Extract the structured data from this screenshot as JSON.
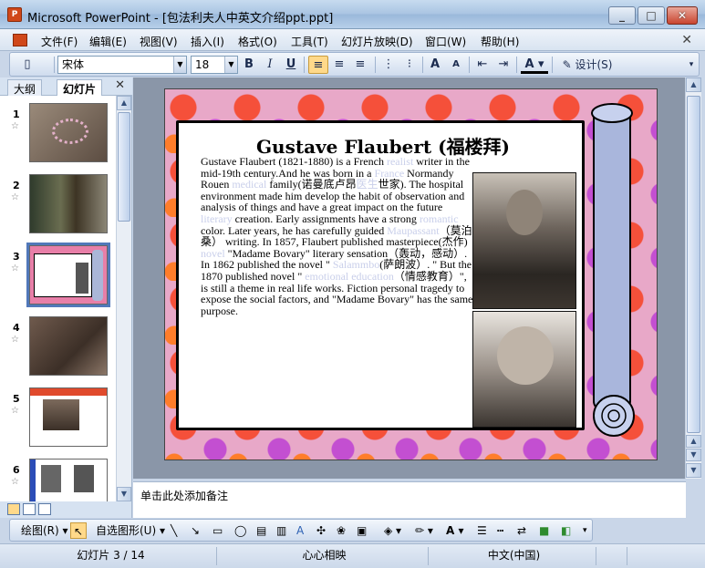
{
  "window": {
    "title": "Microsoft PowerPoint - [包法利夫人中英文介绍ppt.ppt]",
    "app_icon": "powerpoint-icon"
  },
  "menu": {
    "items": [
      "文件(F)",
      "编辑(E)",
      "视图(V)",
      "插入(I)",
      "格式(O)",
      "工具(T)",
      "幻灯片放映(D)",
      "窗口(W)",
      "帮助(H)"
    ]
  },
  "toolbar": {
    "font_name": "宋体",
    "font_size": "18",
    "bold": "B",
    "italic": "I",
    "underline": "U",
    "design_label": "设计(S)"
  },
  "left_pane": {
    "tabs": [
      "大纲",
      "幻灯片"
    ],
    "active_tab": "幻灯片",
    "slides": [
      {
        "num": "1"
      },
      {
        "num": "2"
      },
      {
        "num": "3",
        "selected": true
      },
      {
        "num": "4"
      },
      {
        "num": "5"
      },
      {
        "num": "6"
      }
    ]
  },
  "slide": {
    "title": "Gustave Flaubert (福楼拜)",
    "body_parts": [
      {
        "t": "Gustave Flaubert (1821-1880) is a French "
      },
      {
        "t": "realist",
        "hl": true
      },
      {
        "t": " writer in the mid-19th century.And he was born in a "
      },
      {
        "t": "France",
        "hl": true
      },
      {
        "t": " Normandy Rouen "
      },
      {
        "t": "medical",
        "hl": true
      },
      {
        "t": " family(诺曼底卢昂"
      },
      {
        "t": "医生",
        "hl": true
      },
      {
        "t": "世家). The hospital environment made him develop the habit of observation and analysis of things and have a great impact on the future "
      },
      {
        "t": "literary",
        "hl": true
      },
      {
        "t": " creation.  Early assignments have a strong "
      },
      {
        "t": "romantic",
        "hl": true
      },
      {
        "t": " color. Later years, he has carefully guided "
      },
      {
        "t": "Maupassant",
        "hl": true
      },
      {
        "t": "（莫泊桑） writing. In 1857, Flaubert published masterpiece(杰作) "
      },
      {
        "t": "novel",
        "hl": true
      },
      {
        "t": " \"Madame Bovary\" literary sensation（轰动，感动）. In 1862 published the novel \" "
      },
      {
        "t": "Salammbo",
        "hl": true
      },
      {
        "t": "(萨朗波）. \"  But the 1870 published novel \" "
      },
      {
        "t": "emotional education",
        "hl": true
      },
      {
        "t": "（情感教育）\", is still a theme in real life works.  Fiction personal tragedy to expose the social factors, and \"Madame Bovary\" has the same purpose."
      }
    ]
  },
  "notes": {
    "placeholder": "单击此处添加备注"
  },
  "draw_toolbar": {
    "draw_label": "绘图(R)",
    "autoshape_label": "自选图形(U)"
  },
  "status": {
    "slide_info": "幻灯片 3 / 14",
    "design": "心心相映",
    "language": "中文(中国)"
  }
}
